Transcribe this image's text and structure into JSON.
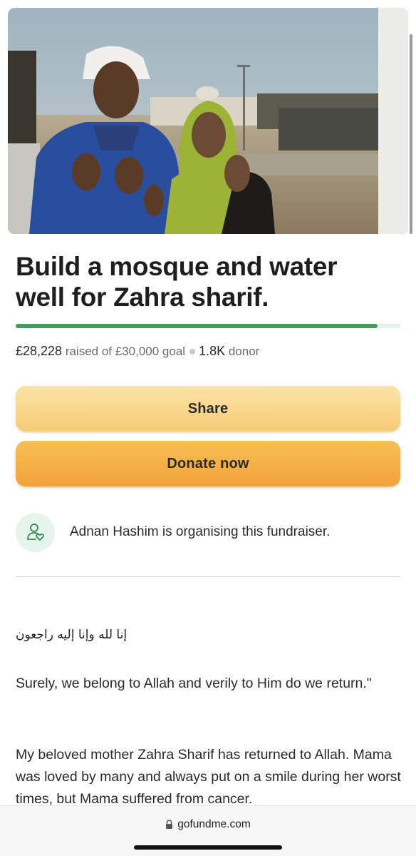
{
  "campaign": {
    "image_alt": "",
    "title": "Build a mosque and water well for Zahra sharif.",
    "progress_fraction": 0.941,
    "raised_amount": "£28,228",
    "raised_of_text": "raised of £30,000 goal",
    "donor_count": "1.8K",
    "donor_label": "donor"
  },
  "actions": {
    "share_label": "Share",
    "donate_label": "Donate now"
  },
  "organiser": {
    "icon": "person-heart-icon",
    "text": "Adnan Hashim is organising this fundraiser."
  },
  "story": {
    "arabic_line": "إنا لله وإنا إليه راجعون",
    "paragraph1": "Surely, we belong to Allah and verily to Him do we return.\"",
    "paragraph2": "My beloved mother Zahra Sharif has returned to Allah. Mama was loved by many and always put on a smile during her worst times, but Mama suffered from cancer."
  },
  "browser": {
    "url": "gofundme.com",
    "lock_icon": "lock-icon"
  },
  "colors": {
    "progress": "#3e9e61",
    "progress_track": "#e3f2e8",
    "share_button": "#f6cb76",
    "donate_button": "#f0a33a",
    "organiser_avatar_bg": "#e6f4ec"
  }
}
